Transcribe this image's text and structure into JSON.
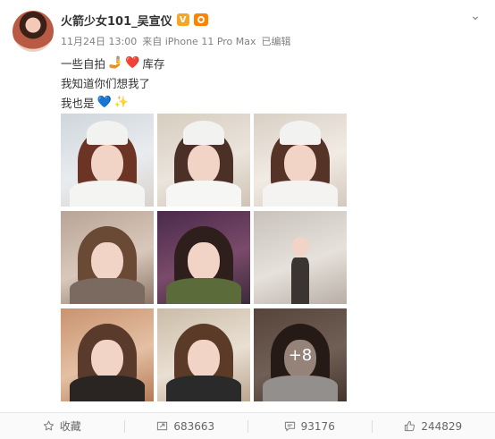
{
  "post": {
    "author": "火箭少女101_吴宣仪",
    "verified_badge": "V",
    "meta": {
      "date": "11月24日 13:00",
      "source": "来自 iPhone 11 Pro Max",
      "edited": "已编辑"
    },
    "lines": [
      {
        "text": "一些自拍",
        "emoji": "🤳",
        "emoji2": "❤️",
        "suffix": "库存"
      },
      {
        "text": "我知道你们想我了"
      },
      {
        "text": "我也是",
        "emoji": "💙",
        "emoji2": "✨"
      }
    ],
    "more_photos": "+8"
  },
  "actions": {
    "favorite": "收藏",
    "repost": "683663",
    "comment": "93176",
    "like": "244829"
  },
  "colors": {
    "meta_gray": "#808080",
    "verified": "#f5a623",
    "member": "#ff8200"
  }
}
